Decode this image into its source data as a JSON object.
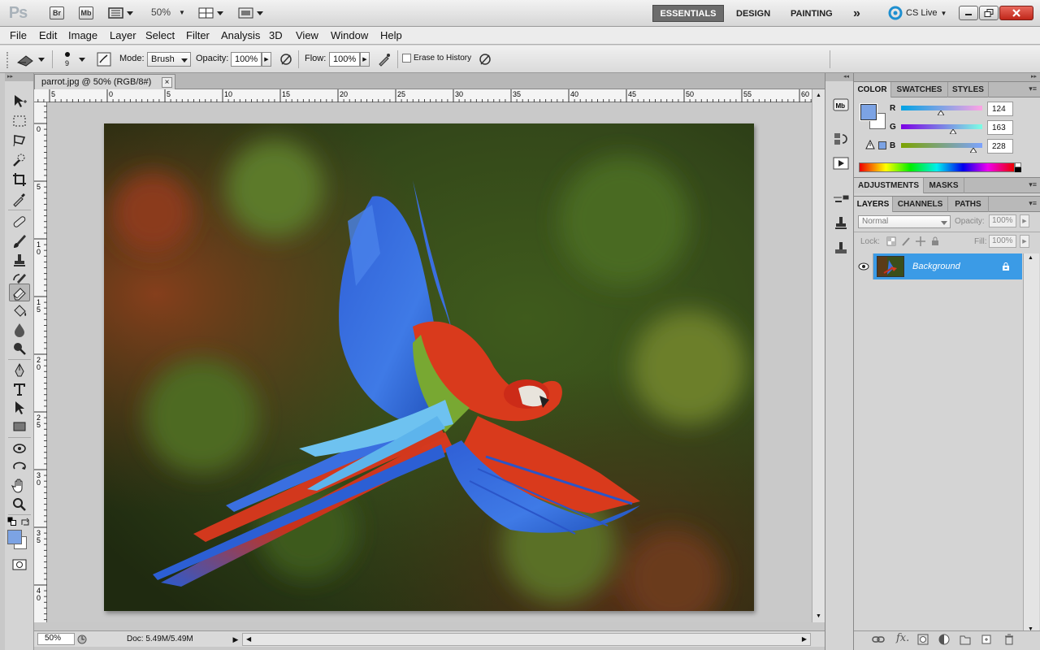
{
  "app": {
    "logo": "Ps",
    "bridge_label": "Br",
    "minibridge_label": "Mb",
    "zoom": "50%",
    "workspaces": [
      "ESSENTIALS",
      "DESIGN",
      "PAINTING"
    ],
    "active_workspace": "ESSENTIALS",
    "cslive_label": "CS Live",
    "overflow": "»"
  },
  "menu": [
    "File",
    "Edit",
    "Image",
    "Layer",
    "Select",
    "Filter",
    "Analysis",
    "3D",
    "View",
    "Window",
    "Help"
  ],
  "options": {
    "brush_size": "9",
    "mode_label": "Mode:",
    "mode_value": "Brush",
    "opacity_label": "Opacity:",
    "opacity_value": "100%",
    "flow_label": "Flow:",
    "flow_value": "100%",
    "erase_history_label": "Erase to History"
  },
  "document": {
    "tab_title": "parrot.jpg @ 50% (RGB/8#)",
    "close_label": "×",
    "ruler_h": [
      "5",
      "0",
      "5",
      "10",
      "15",
      "20",
      "25",
      "30",
      "35",
      "40",
      "45",
      "50",
      "55",
      "60"
    ],
    "ruler_v": [
      "0",
      "5",
      "1\n0",
      "1\n5",
      "2\n0",
      "2\n5",
      "3\n0",
      "3\n5",
      "4\n0"
    ]
  },
  "status": {
    "zoom": "50%",
    "doc_info": "Doc: 5.49M/5.49M"
  },
  "color_panel": {
    "tabs": [
      "COLOR",
      "SWATCHES",
      "STYLES"
    ],
    "r_label": "R",
    "g_label": "G",
    "b_label": "B",
    "r": "124",
    "g": "163",
    "b": "228",
    "r_frac": 0.486,
    "g_frac": 0.639,
    "b_frac": 0.894,
    "fg_color": "#7ca3e4",
    "bg_color": "#ffffff"
  },
  "adjust_panel": {
    "tabs": [
      "ADJUSTMENTS",
      "MASKS"
    ]
  },
  "layers_panel": {
    "tabs": [
      "LAYERS",
      "CHANNELS",
      "PATHS"
    ],
    "blend_mode": "Normal",
    "opacity_label": "Opacity:",
    "opacity_value": "100%",
    "lock_label": "Lock:",
    "fill_label": "Fill:",
    "fill_value": "100%",
    "layers": [
      {
        "name": "Background",
        "selected": true,
        "visible": true,
        "locked": true
      }
    ]
  },
  "colors": {
    "accent": "#3b9be6",
    "workspace_active_bg": "#6c6c6c",
    "close_btn": "#d9352a"
  }
}
